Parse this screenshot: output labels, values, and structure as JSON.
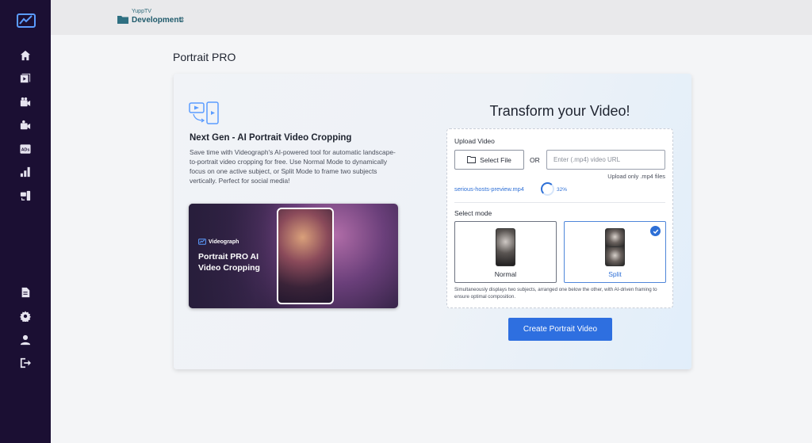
{
  "app": {
    "brand_icon": "videograph-logo-icon",
    "accent_color": "#2e6fe0",
    "sidebar_bg": "#1b0f33"
  },
  "workspace": {
    "org": "YuppTV",
    "name": "Development",
    "chevron": "⌃⌄"
  },
  "sidebar": {
    "items": [
      {
        "icon": "home-icon"
      },
      {
        "icon": "video-library-icon"
      },
      {
        "icon": "camera-icon"
      },
      {
        "icon": "live-camera-icon"
      },
      {
        "icon": "ads-icon",
        "text": "ADs"
      },
      {
        "icon": "analytics-icon"
      },
      {
        "icon": "portrait-pro-icon"
      }
    ],
    "bottom_items": [
      {
        "icon": "document-icon"
      },
      {
        "icon": "settings-icon"
      },
      {
        "icon": "user-icon"
      },
      {
        "icon": "logout-icon"
      }
    ]
  },
  "page": {
    "title": "Portrait PRO"
  },
  "feature": {
    "title": "Next Gen - AI  Portrait Video Cropping",
    "description": "Save time with Videograph's AI-powered tool for automatic landscape-to-portrait video cropping for free. Use Normal Mode to dynamically focus on one active subject, or Split Mode to frame two subjects vertically. Perfect for social media!",
    "promo_brand": "Videograph",
    "promo_title": "Portrait PRO AI Video Cropping"
  },
  "transform": {
    "title": "Transform your Video!",
    "upload_label": "Upload Video",
    "select_file_label": "Select File",
    "or_label": "OR",
    "url_placeholder": "Enter (.mp4) video URL",
    "upload_hint": "Upload only .mp4 files",
    "file_name": "serious-hosts-preview.mp4",
    "progress_text": "32%",
    "progress_value": 0.32,
    "select_mode_label": "Select mode",
    "modes": [
      {
        "label": "Normal",
        "selected": false
      },
      {
        "label": "Split",
        "selected": true
      }
    ],
    "mode_description": "Simultaneously displays two subjects, arranged one below the other, with AI-driven framing to ensure optimal composition.",
    "create_button": "Create Portrait Video"
  }
}
